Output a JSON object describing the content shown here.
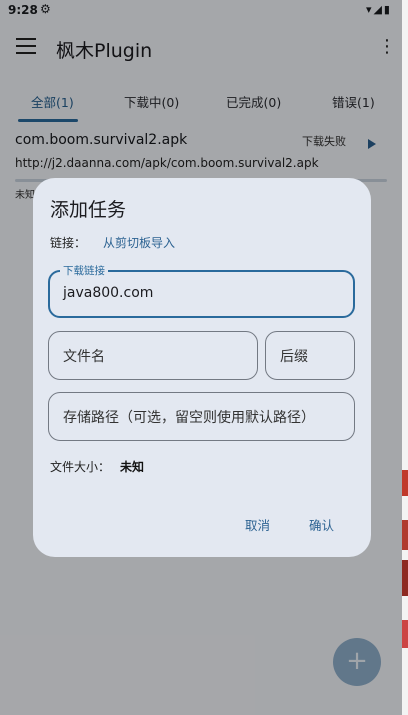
{
  "status_bar": {
    "time": "9:28",
    "settings_icon": "gear-icon",
    "right_icons": "wifi-icon signal-icon battery-icon"
  },
  "app_bar": {
    "title": "枫木Plugin",
    "menu_icon": "hamburger-menu-icon",
    "more_icon": "more-vert-icon"
  },
  "tabs": [
    {
      "label": "全部(1)",
      "active": true
    },
    {
      "label": "下载中(0)",
      "active": false
    },
    {
      "label": "已完成(0)",
      "active": false
    },
    {
      "label": "错误(1)",
      "active": false
    }
  ],
  "download_item": {
    "name": "com.boom.survival2.apk",
    "status": "下载失败",
    "url": "http://j2.daanna.com/apk/com.boom.survival2.apk",
    "size": "未知"
  },
  "dialog": {
    "title": "添加任务",
    "link_label": "链接：",
    "paste_link": "从剪切板导入",
    "url_field": {
      "label": "下载链接",
      "value": "java800.com"
    },
    "filename_placeholder": "文件名",
    "suffix_placeholder": "后缀",
    "path_placeholder": "存储路径（可选，留空则使用默认路径）",
    "file_size_label": "文件大小：",
    "file_size_value": "未知",
    "cancel": "取消",
    "confirm": "确认"
  },
  "fab": {
    "label": "+"
  },
  "colors": {
    "primary": "#2a6a9c",
    "dialog_bg": "#e3e8f1",
    "fab": "#8fb0cc"
  }
}
